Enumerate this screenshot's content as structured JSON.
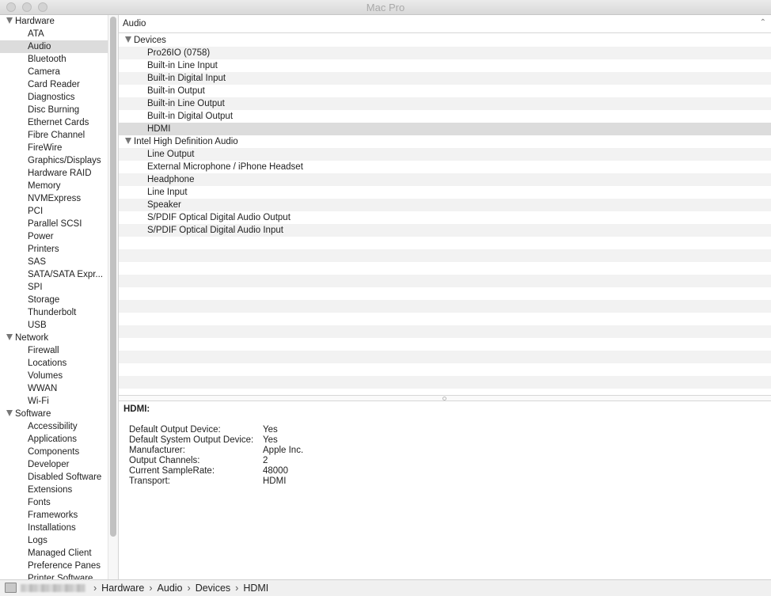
{
  "window": {
    "title": "Mac Pro"
  },
  "sidebar": {
    "rows": [
      {
        "type": "group",
        "label": "Hardware"
      },
      {
        "type": "item",
        "label": "ATA"
      },
      {
        "type": "item",
        "label": "Audio",
        "selected": true
      },
      {
        "type": "item",
        "label": "Bluetooth"
      },
      {
        "type": "item",
        "label": "Camera"
      },
      {
        "type": "item",
        "label": "Card Reader"
      },
      {
        "type": "item",
        "label": "Diagnostics"
      },
      {
        "type": "item",
        "label": "Disc Burning"
      },
      {
        "type": "item",
        "label": "Ethernet Cards"
      },
      {
        "type": "item",
        "label": "Fibre Channel"
      },
      {
        "type": "item",
        "label": "FireWire"
      },
      {
        "type": "item",
        "label": "Graphics/Displays"
      },
      {
        "type": "item",
        "label": "Hardware RAID"
      },
      {
        "type": "item",
        "label": "Memory"
      },
      {
        "type": "item",
        "label": "NVMExpress"
      },
      {
        "type": "item",
        "label": "PCI"
      },
      {
        "type": "item",
        "label": "Parallel SCSI"
      },
      {
        "type": "item",
        "label": "Power"
      },
      {
        "type": "item",
        "label": "Printers"
      },
      {
        "type": "item",
        "label": "SAS"
      },
      {
        "type": "item",
        "label": "SATA/SATA Expr..."
      },
      {
        "type": "item",
        "label": "SPI"
      },
      {
        "type": "item",
        "label": "Storage"
      },
      {
        "type": "item",
        "label": "Thunderbolt"
      },
      {
        "type": "item",
        "label": "USB"
      },
      {
        "type": "group",
        "label": "Network"
      },
      {
        "type": "item",
        "label": "Firewall"
      },
      {
        "type": "item",
        "label": "Locations"
      },
      {
        "type": "item",
        "label": "Volumes"
      },
      {
        "type": "item",
        "label": "WWAN"
      },
      {
        "type": "item",
        "label": "Wi-Fi"
      },
      {
        "type": "group",
        "label": "Software"
      },
      {
        "type": "item",
        "label": "Accessibility"
      },
      {
        "type": "item",
        "label": "Applications"
      },
      {
        "type": "item",
        "label": "Components"
      },
      {
        "type": "item",
        "label": "Developer"
      },
      {
        "type": "item",
        "label": "Disabled Software"
      },
      {
        "type": "item",
        "label": "Extensions"
      },
      {
        "type": "item",
        "label": "Fonts"
      },
      {
        "type": "item",
        "label": "Frameworks"
      },
      {
        "type": "item",
        "label": "Installations"
      },
      {
        "type": "item",
        "label": "Logs"
      },
      {
        "type": "item",
        "label": "Managed Client"
      },
      {
        "type": "item",
        "label": "Preference Panes"
      },
      {
        "type": "item",
        "label": "Printer Software"
      }
    ]
  },
  "main": {
    "header": "Audio",
    "tree": [
      {
        "type": "group",
        "label": "Devices"
      },
      {
        "type": "item",
        "label": "Pro26IO (0758)"
      },
      {
        "type": "item",
        "label": "Built-in Line Input"
      },
      {
        "type": "item",
        "label": "Built-in Digital Input"
      },
      {
        "type": "item",
        "label": "Built-in Output"
      },
      {
        "type": "item",
        "label": "Built-in Line Output"
      },
      {
        "type": "item",
        "label": "Built-in Digital Output"
      },
      {
        "type": "item",
        "label": "HDMI",
        "selected": true
      },
      {
        "type": "group",
        "label": "Intel High Definition Audio"
      },
      {
        "type": "item",
        "label": "Line Output"
      },
      {
        "type": "item",
        "label": "External Microphone / iPhone Headset"
      },
      {
        "type": "item",
        "label": "Headphone"
      },
      {
        "type": "item",
        "label": "Line Input"
      },
      {
        "type": "item",
        "label": "Speaker"
      },
      {
        "type": "item",
        "label": "S/PDIF Optical Digital Audio Output"
      },
      {
        "type": "item",
        "label": "S/PDIF Optical Digital Audio Input"
      }
    ],
    "detail": {
      "title": "HDMI:",
      "properties": [
        {
          "name": "Default Output Device:",
          "value": "Yes"
        },
        {
          "name": "Default System Output Device:",
          "value": "Yes"
        },
        {
          "name": "Manufacturer:",
          "value": "Apple Inc."
        },
        {
          "name": "Output Channels:",
          "value": "2"
        },
        {
          "name": "Current SampleRate:",
          "value": "48000"
        },
        {
          "name": "Transport:",
          "value": "HDMI"
        }
      ]
    }
  },
  "pathbar": {
    "crumbs": [
      "Hardware",
      "Audio",
      "Devices",
      "HDMI"
    ]
  }
}
